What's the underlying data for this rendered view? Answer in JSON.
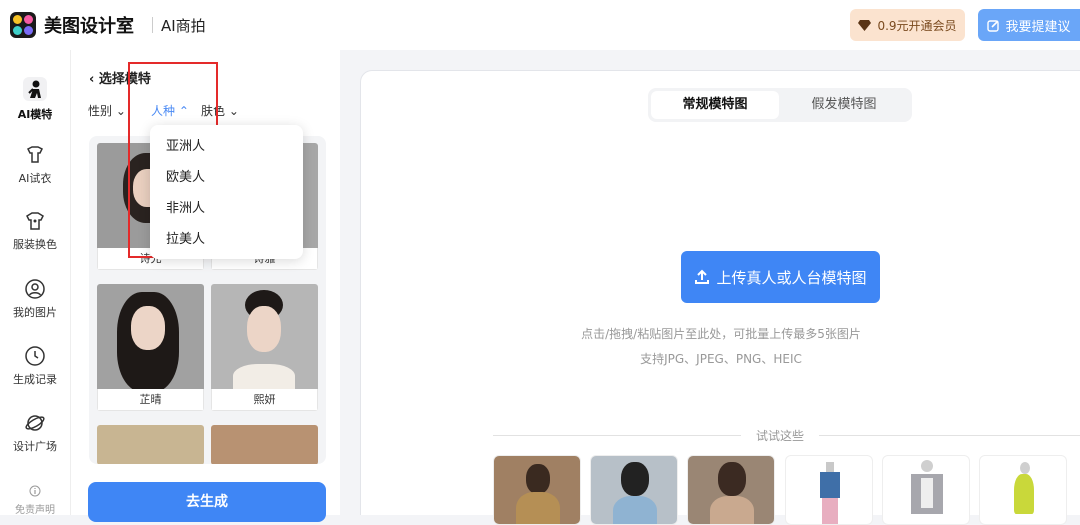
{
  "header": {
    "brand": "美图设计室",
    "subtitle": "AI商拍",
    "vip_label": "0.9元开通会员",
    "suggest_label": "我要提建议"
  },
  "sidebar": {
    "items": [
      {
        "label": "AI模特",
        "icon": "person-icon"
      },
      {
        "label": "AI试衣",
        "icon": "hanger-shirt-icon"
      },
      {
        "label": "服装换色",
        "icon": "tshirt-icon"
      },
      {
        "label": "我的图片",
        "icon": "user-circle-icon"
      },
      {
        "label": "生成记录",
        "icon": "clock-icon"
      },
      {
        "label": "设计广场",
        "icon": "planet-icon"
      },
      {
        "label": "免责声明",
        "icon": "info-icon"
      }
    ]
  },
  "panel": {
    "back_label": "选择模特",
    "filters": {
      "gender": "性别",
      "race": "人种",
      "skin": "肤色"
    },
    "models": [
      {
        "name": "诗允"
      },
      {
        "name": "诗雅"
      },
      {
        "name": "芷晴"
      },
      {
        "name": "熙妍"
      }
    ],
    "generate_label": "去生成"
  },
  "dropdown": {
    "options": [
      "亚洲人",
      "欧美人",
      "非洲人",
      "拉美人"
    ]
  },
  "main": {
    "tabs": [
      "常规模特图",
      "假发模特图"
    ],
    "upload_label": "上传真人或人台模特图",
    "hint1": "点击/拖拽/粘贴图片至此处，可批量上传最多5张图片",
    "hint2": "支持JPG、JPEG、PNG、HEIC",
    "try_label": "试试这些"
  },
  "colors": {
    "accent": "#3f86f5",
    "vip_bg": "#fbe3cf",
    "highlight": "#e42a2a"
  }
}
